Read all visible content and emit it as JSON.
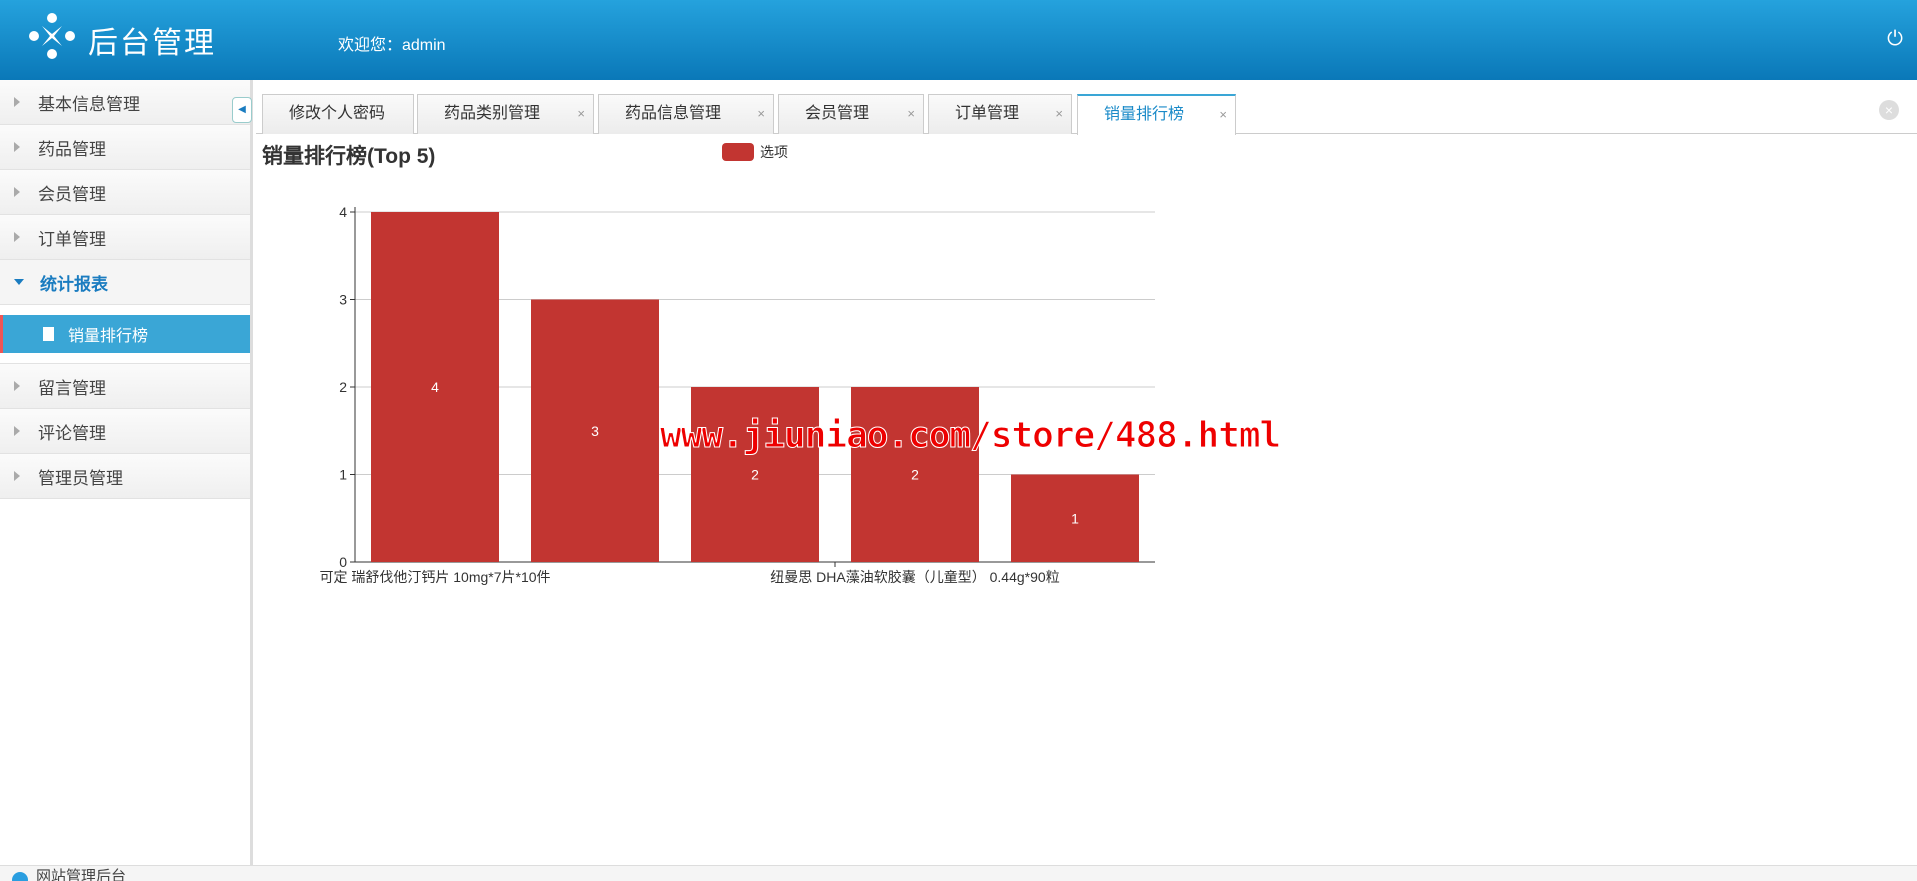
{
  "header": {
    "title": "后台管理",
    "welcome": "欢迎您：admin",
    "power_icon": "power-icon"
  },
  "sidebar": {
    "items": [
      {
        "label": "基本信息管理"
      },
      {
        "label": "药品管理"
      },
      {
        "label": "会员管理"
      },
      {
        "label": "订单管理"
      },
      {
        "label": "统计报表",
        "open": true,
        "children": [
          {
            "label": "销量排行榜",
            "active": true
          }
        ]
      },
      {
        "label": "留言管理"
      },
      {
        "label": "评论管理"
      },
      {
        "label": "管理员管理"
      }
    ]
  },
  "tabs": [
    {
      "label": "修改个人密码",
      "closable": false
    },
    {
      "label": "药品类别管理",
      "closable": true
    },
    {
      "label": "药品信息管理",
      "closable": true
    },
    {
      "label": "会员管理",
      "closable": true
    },
    {
      "label": "订单管理",
      "closable": true
    },
    {
      "label": "销量排行榜",
      "closable": true,
      "active": true
    }
  ],
  "close_symbol": "×",
  "chart_data": {
    "type": "bar",
    "title": "销量排行榜(Top 5)",
    "legend": [
      "选项"
    ],
    "legend_position": "top-center",
    "categories": [
      "可定 瑞舒伐他汀钙片 10mg*7片*10件",
      "",
      "",
      "纽曼思 DHA藻油软胶囊（儿童型） 0.44g*90粒",
      ""
    ],
    "values": [
      4,
      3,
      2,
      2,
      1
    ],
    "yticks": [
      "0",
      "1",
      "2",
      "3",
      "4"
    ],
    "ylim": [
      0,
      4
    ],
    "grid": true,
    "color": "#c23531"
  },
  "watermark": "www.jiuniao.com/store/488.html",
  "footer": {
    "text": "网站管理后台"
  }
}
